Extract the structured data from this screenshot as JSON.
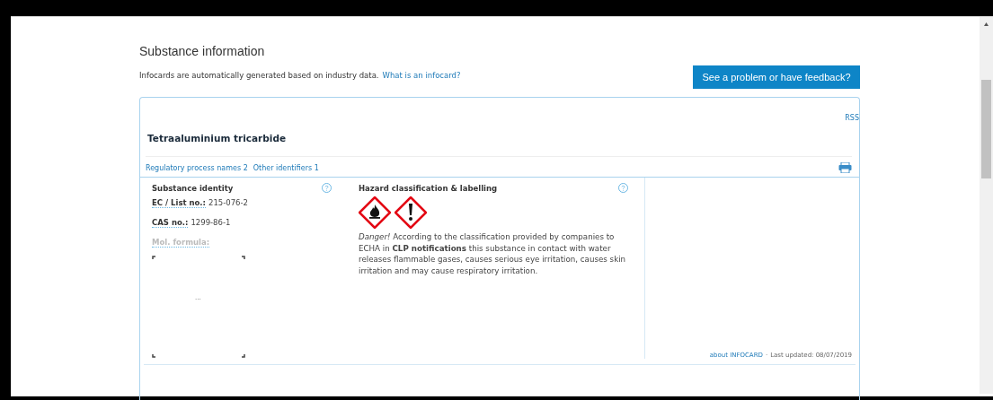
{
  "header": {
    "title": "Substance information",
    "intro": "Infocards are automatically generated based on industry data.",
    "intro_link": "What is an infocard?",
    "feedback_button": "See a problem or have feedback?"
  },
  "infocard": {
    "rss": "RSS",
    "name": "Tetraaluminium tricarbide",
    "links": [
      "Regulatory process names 2",
      "Other identifiers 1"
    ],
    "identity": {
      "title": "Substance identity",
      "identifiers": [
        {
          "label": "EC / List no.:",
          "value": "215-076-2",
          "disabled": false
        },
        {
          "label": "CAS no.:",
          "value": "1299-86-1",
          "disabled": false
        },
        {
          "label": "Mol. formula:",
          "disabled": true
        }
      ],
      "structure_placeholder": "..."
    },
    "hazard": {
      "title": "Hazard classification & labelling",
      "pictograms": [
        {
          "kind": "flame"
        },
        {
          "kind": "exclamation"
        }
      ],
      "text": "*Danger!* According to the classification provided by companies to ECHA in **CLP notifications** this substance in contact with water releases flammable gases, causes serious eye irritation, causes skin irritation and may cause respiratory irritation."
    },
    "footer": {
      "about_link": "about INFOCARD",
      "separator": "·",
      "updated": "Last updated: 08/07/2019"
    }
  }
}
